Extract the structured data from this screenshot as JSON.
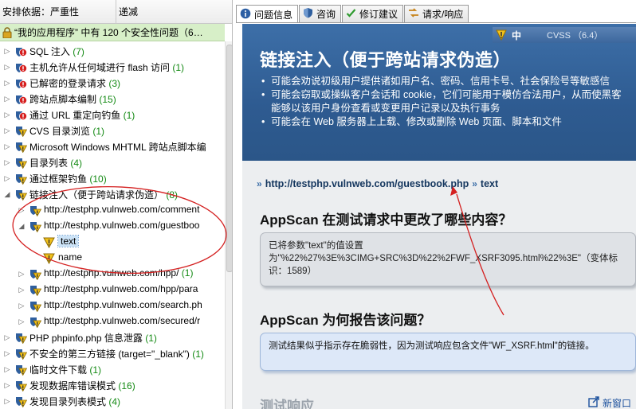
{
  "sort_header": {
    "sort_by": "安排依据：严重性",
    "order": "递减"
  },
  "summary": {
    "text": "“我的应用程序” 中有   120   个安全性问题（6…"
  },
  "tree": [
    {
      "label": "SQL 注入",
      "count": "(7)",
      "sev": "high"
    },
    {
      "label": "主机允许从任何域进行 flash 访问",
      "count": "(1)",
      "sev": "high"
    },
    {
      "label": "已解密的登录请求",
      "count": "(3)",
      "sev": "high"
    },
    {
      "label": "跨站点脚本编制",
      "count": "(15)",
      "sev": "high"
    },
    {
      "label": "通过 URL 重定向钓鱼",
      "count": "(1)",
      "sev": "high"
    },
    {
      "label": "CVS 目录浏览",
      "count": "(1)",
      "sev": "med"
    },
    {
      "label": "Microsoft Windows MHTML 跨站点脚本编",
      "count": "",
      "sev": "med"
    },
    {
      "label": "目录列表",
      "count": "(4)",
      "sev": "med"
    },
    {
      "label": "通过框架钓鱼",
      "count": "(10)",
      "sev": "med"
    },
    {
      "label": "链接注入（便于跨站请求伪造）",
      "count": "(8)",
      "sev": "med"
    },
    {
      "label": "http://testphp.vulnweb.com/comment",
      "count": "",
      "sev": "med"
    },
    {
      "label": "http://testphp.vulnweb.com/guestboo",
      "count": "",
      "sev": "med"
    },
    {
      "label": "text",
      "count": "",
      "sev": "param"
    },
    {
      "label": "name",
      "count": "",
      "sev": "param"
    },
    {
      "label": "http://testphp.vulnweb.com/hpp/",
      "count": "(1)",
      "sev": "med"
    },
    {
      "label": "http://testphp.vulnweb.com/hpp/para",
      "count": "",
      "sev": "med"
    },
    {
      "label": "http://testphp.vulnweb.com/search.ph",
      "count": "",
      "sev": "med"
    },
    {
      "label": "http://testphp.vulnweb.com/secured/r",
      "count": "",
      "sev": "med"
    },
    {
      "label": "PHP phpinfo.php 信息泄露",
      "count": "(1)",
      "sev": "med"
    },
    {
      "label": "不安全的第三方链接 (target=\"_blank\")",
      "count": "(1)",
      "sev": "med"
    },
    {
      "label": "临时文件下载",
      "count": "(1)",
      "sev": "med"
    },
    {
      "label": "发现数据库错误模式",
      "count": "(16)",
      "sev": "med"
    },
    {
      "label": "发现目录列表模式",
      "count": "(4)",
      "sev": "med"
    }
  ],
  "tabs": [
    {
      "label": "问题信息",
      "icon": "info-icon"
    },
    {
      "label": "咨询",
      "icon": "shield-icon"
    },
    {
      "label": "修订建议",
      "icon": "check-icon"
    },
    {
      "label": "请求/响应",
      "icon": "arrows-icon"
    }
  ],
  "severity": {
    "level": "中",
    "cvss": "CVSS  （6.4）"
  },
  "issue": {
    "title": "链接注入（便于跨站请求伪造）",
    "bullets": [
      "可能会劝说初级用户提供诸如用户名、密码、信用卡号、社会保险号等敏感信",
      "可能会窃取或操纵客户会话和 cookie，它们可能用于模仿合法用户，从而使黑客能够以该用户身份查看或变更用户记录以及执行事务",
      "可能会在 Web 服务器上上载、修改或删除 Web 页面、脚本和文件"
    ]
  },
  "location": {
    "url": "http://testphp.vulnweb.com/guestbook.php",
    "param": "text"
  },
  "changed": {
    "heading": "AppScan 在测试请求中更改了哪些内容？",
    "text": "已将参数\"text\"的值设置为\"%22%27%3E%3CIMG+SRC%3D%22%2FWF_XSRF3095.html%22%3E\"（变体标识：1589）"
  },
  "why": {
    "heading": "AppScan 为何报告该问题？",
    "text": "测试结果似乎指示存在脆弱性，因为测试响应包含文件\"WF_XSRF.html\"的链接。"
  },
  "response": {
    "heading": "测试响应",
    "new_window": "新窗口"
  },
  "colors": {
    "banner": "#2e5b91",
    "count_green": "#148a14",
    "annotation_red": "#d42020"
  }
}
